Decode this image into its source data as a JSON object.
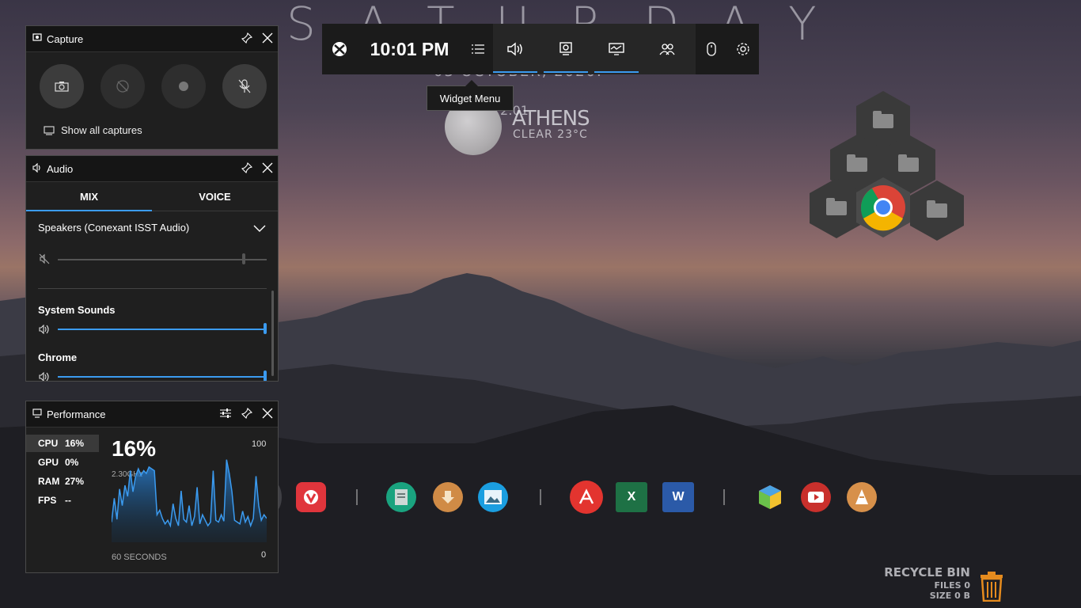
{
  "desktop": {
    "big_word": "SATURDAY",
    "date_line": "03 OCTOBER, 2020.",
    "time_line": "2:01",
    "city": "ATHENS",
    "weather": "CLEAR 23°C",
    "recycle": {
      "title": "RECYCLE BIN",
      "files": "FILES 0",
      "size": "SIZE 0 B"
    },
    "dock_icons": [
      "steam-icon",
      "vivaldi-icon",
      "docs-icon",
      "downloads-icon",
      "photos-icon",
      "acrobat-icon",
      "excel-icon",
      "word-icon",
      "rubik-icon",
      "youtube-icon",
      "vlc-icon"
    ]
  },
  "gamebar": {
    "clock": "10:01 PM",
    "tooltip": "Widget Menu",
    "widgets": [
      "xbox-icon",
      "widget-menu-icon",
      "audio-icon",
      "capture-icon",
      "performance-icon",
      "social-icon",
      "mouse-icon",
      "settings-icon"
    ],
    "accent": "#3b9bf0"
  },
  "capture": {
    "title": "Capture",
    "show_all": "Show all captures"
  },
  "audio": {
    "title": "Audio",
    "tabs": [
      "MIX",
      "VOICE"
    ],
    "active_tab": "MIX",
    "device": "Speakers (Conexant ISST Audio)",
    "device_volume": 0.89,
    "device_muted": true,
    "apps": [
      {
        "name": "System Sounds",
        "volume": 1.0
      },
      {
        "name": "Chrome",
        "volume": 1.0
      }
    ]
  },
  "performance": {
    "title": "Performance",
    "stats": [
      {
        "label": "CPU",
        "value": "16%"
      },
      {
        "label": "GPU",
        "value": "0%"
      },
      {
        "label": "RAM",
        "value": "27%"
      },
      {
        "label": "FPS",
        "value": "--"
      }
    ],
    "selected": "CPU",
    "big_value": "16%",
    "freq": "2.30GHz",
    "axis_max": "100",
    "axis_min": "0",
    "duration": "60 SECONDS"
  },
  "chart_data": {
    "type": "area",
    "ylim": [
      0,
      100
    ],
    "values": [
      22,
      48,
      25,
      58,
      40,
      62,
      50,
      78,
      55,
      72,
      80,
      73,
      78,
      75,
      82,
      80,
      78,
      30,
      35,
      26,
      20,
      24,
      18,
      42,
      26,
      18,
      56,
      25,
      22,
      40,
      18,
      28,
      60,
      20,
      30,
      24,
      18,
      22,
      78,
      24,
      22,
      30,
      23,
      90,
      75,
      55,
      24,
      22,
      20,
      34,
      22,
      28,
      18,
      26,
      72,
      40,
      24,
      30,
      26
    ]
  }
}
